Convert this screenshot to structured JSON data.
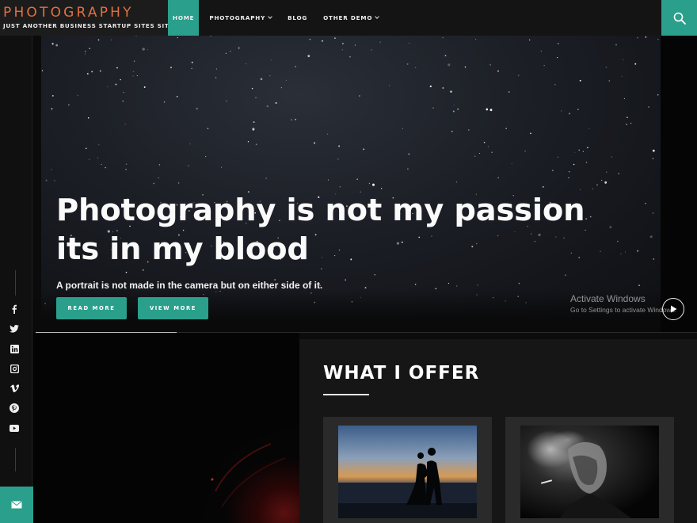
{
  "site": {
    "title": "PHOTOGRAPHY",
    "tagline": "JUST ANOTHER BUSINESS STARTUP SITES SITE"
  },
  "nav": {
    "items": [
      {
        "label": "HOME",
        "active": true,
        "dropdown": false
      },
      {
        "label": "PHOTOGRAPHY",
        "active": false,
        "dropdown": true
      },
      {
        "label": "BLOG",
        "active": false,
        "dropdown": false
      },
      {
        "label": "OTHER DEMO",
        "active": false,
        "dropdown": true
      }
    ]
  },
  "header_icons": {
    "search": "search-icon"
  },
  "social": [
    "facebook-icon",
    "twitter-icon",
    "linkedin-icon",
    "instagram-icon",
    "vimeo-icon",
    "pinterest-icon",
    "youtube-icon"
  ],
  "hero": {
    "title_line1": "Photography is not my passion",
    "title_line2": "its in my blood",
    "subtitle": "A portrait is not made in the camera but on either side of it.",
    "read_more": "READ MORE",
    "view_more": "VIEW MORE"
  },
  "watermark": {
    "title": "Activate Windows",
    "subtitle": "Go to Settings to activate Windows."
  },
  "offer": {
    "title": "WHAT I OFFER"
  },
  "colors": {
    "accent": "#2aa08c",
    "brand": "#e2703f",
    "background": "#0c0c0c",
    "panel": "#161616",
    "card": "#2a2a2a"
  }
}
